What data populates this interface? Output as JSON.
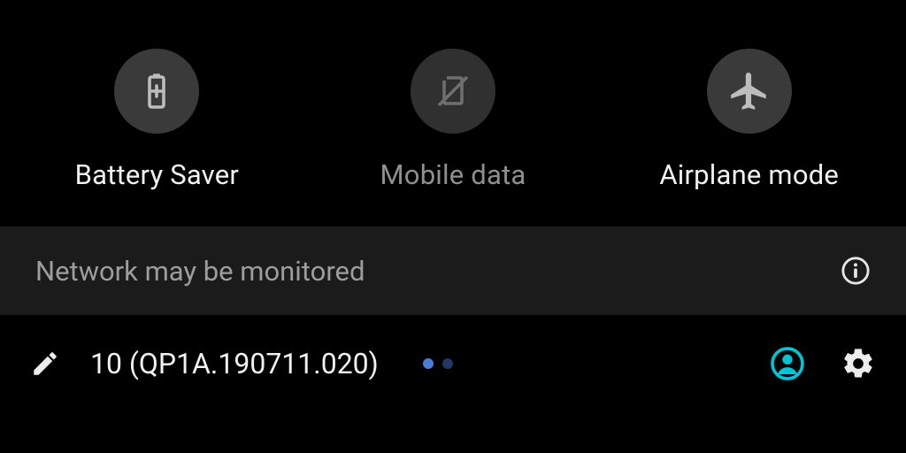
{
  "tiles": [
    {
      "label": "Battery Saver",
      "icon": "battery-saver",
      "enabled": true
    },
    {
      "label": "Mobile data",
      "icon": "mobile-data",
      "enabled": false
    },
    {
      "label": "Airplane mode",
      "icon": "airplane-mode",
      "enabled": true
    }
  ],
  "banner": {
    "text": "Network may be monitored"
  },
  "footer": {
    "build": "10 (QP1A.190711.020)"
  },
  "colors": {
    "accent": "#00c4d6"
  }
}
